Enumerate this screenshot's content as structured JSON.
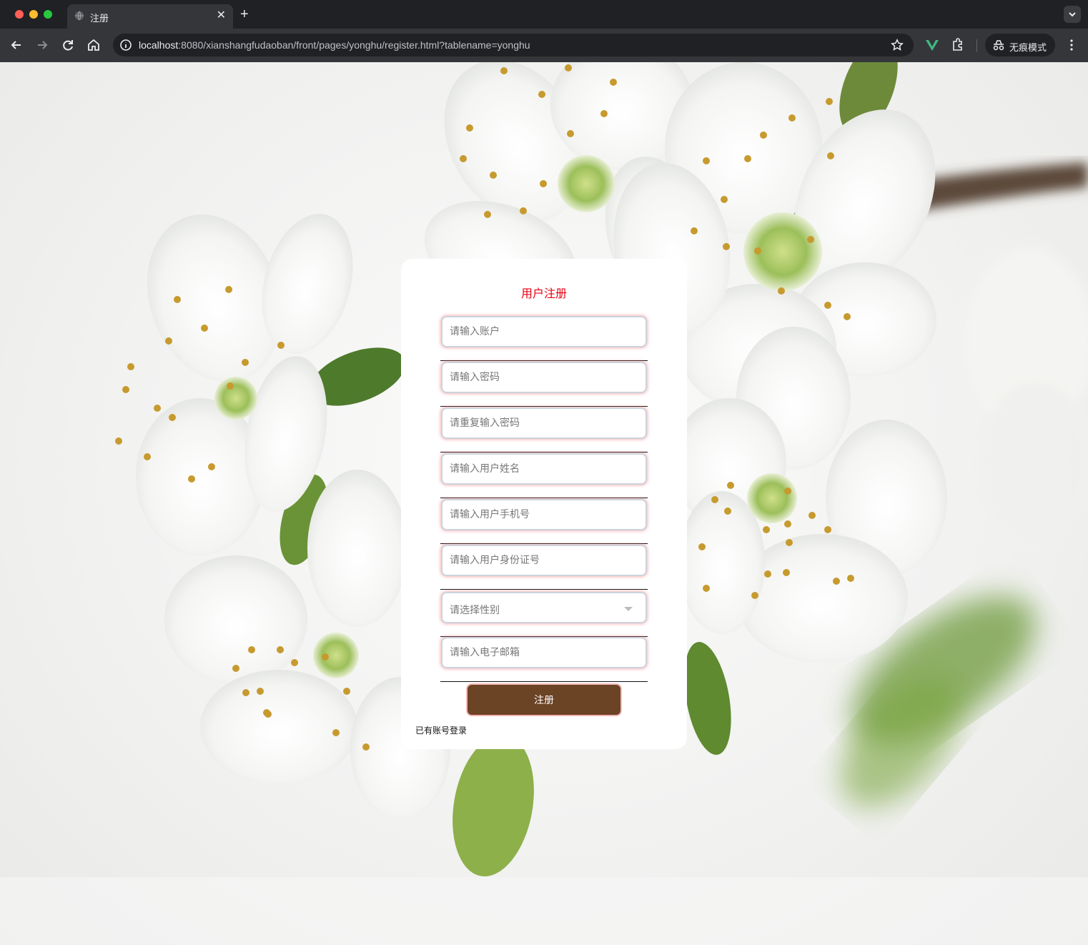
{
  "browser": {
    "tab_title": "注册",
    "url_host": "localhost",
    "url_rest": ":8080/xianshangfudaoban/front/pages/yonghu/register.html?tablename=yonghu",
    "incognito_label": "无痕模式"
  },
  "form": {
    "title": "用户注册",
    "fields": [
      {
        "placeholder": "请输入账户"
      },
      {
        "placeholder": "请输入密码"
      },
      {
        "placeholder": "请重复输入密码"
      },
      {
        "placeholder": "请输入用户姓名"
      },
      {
        "placeholder": "请输入用户手机号"
      },
      {
        "placeholder": "请输入用户身份证号"
      },
      {
        "placeholder": "请选择性别"
      },
      {
        "placeholder": "请输入电子邮箱"
      }
    ],
    "submit_label": "注册",
    "login_link": "已有账号登录"
  },
  "colors": {
    "title": "#e60012",
    "submit_bg": "#6b4325"
  }
}
